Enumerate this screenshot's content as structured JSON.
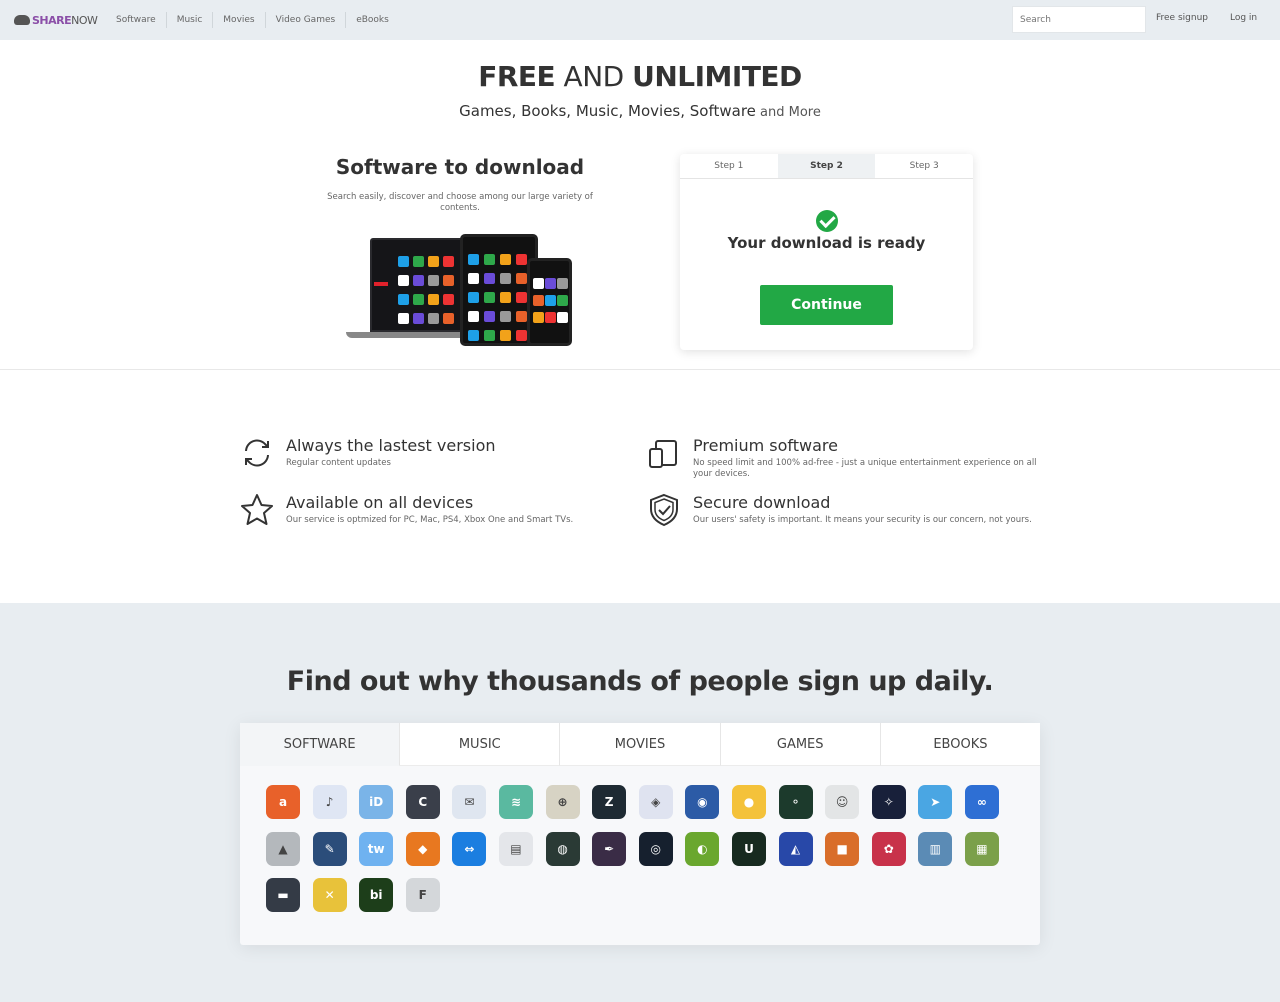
{
  "header": {
    "logo_share": "SHARE",
    "logo_now": "NOW",
    "nav": [
      "Software",
      "Music",
      "Movies",
      "Video Games",
      "eBooks"
    ],
    "search_placeholder": "Search",
    "signup": "Free signup",
    "login": "Log in"
  },
  "hero": {
    "title_free": "FREE",
    "title_and": " AND ",
    "title_unlimited": "UNLIMITED",
    "subtitle_main": "Games, Books, Music, Movies, Software",
    "subtitle_more": " and More"
  },
  "download": {
    "title": "Software to download",
    "description": "Search easily, discover and choose among our large variety of contents.",
    "steps": [
      "Step 1",
      "Step 2",
      "Step 3"
    ],
    "active_step": 1,
    "status": "Your download is ready",
    "continue_label": "Continue"
  },
  "features": [
    {
      "title": "Always the lastest version",
      "desc": "Regular content updates",
      "icon": "refresh-icon"
    },
    {
      "title": "Premium software",
      "desc": "No speed limit and 100% ad-free - just a unique entertainment experience on all your devices.",
      "icon": "devices-icon"
    },
    {
      "title": "Available on all devices",
      "desc": "Our service is optmized for PC, Mac, PS4, Xbox One and Smart TVs.",
      "icon": "star-icon"
    },
    {
      "title": "Secure download",
      "desc": "Our users' safety is important. It means your security is our concern, not yours.",
      "icon": "shield-check-icon"
    }
  ],
  "signup_section": {
    "title": "Find out why thousands of people sign up daily.",
    "tabs": [
      "SOFTWARE",
      "MUSIC",
      "MOVIES",
      "GAMES",
      "EBOOKS"
    ],
    "active_tab": 0,
    "apps": [
      {
        "name": "avast-icon",
        "color": "#e8612a",
        "glyph": "a"
      },
      {
        "name": "audacity-icon",
        "color": "#dfe6f4",
        "glyph": "♪"
      },
      {
        "name": "idrive-icon",
        "color": "#7ab4e8",
        "glyph": "iD"
      },
      {
        "name": "ccleaner-icon",
        "color": "#3a3f4a",
        "glyph": "C"
      },
      {
        "name": "thunderbird-icon",
        "color": "#dfe6f0",
        "glyph": "✉"
      },
      {
        "name": "stack-icon",
        "color": "#5ab9a0",
        "glyph": "≋"
      },
      {
        "name": "compass-icon",
        "color": "#d7d3c4",
        "glyph": "⊕"
      },
      {
        "name": "zoner-icon",
        "color": "#1e2a33",
        "glyph": "Z"
      },
      {
        "name": "shield-app-icon",
        "color": "#dfe3f0",
        "glyph": "◈"
      },
      {
        "name": "pocket-icon",
        "color": "#2c5ba6",
        "glyph": "◉"
      },
      {
        "name": "cow-app-icon",
        "color": "#f4c23a",
        "glyph": "●"
      },
      {
        "name": "gimp-icon",
        "color": "#1c3a2c",
        "glyph": "⚬"
      },
      {
        "name": "waze-icon",
        "color": "#e3e5e6",
        "glyph": "☺"
      },
      {
        "name": "bird-app-icon",
        "color": "#18203a",
        "glyph": "✧"
      },
      {
        "name": "telegram-icon",
        "color": "#4aa6e3",
        "glyph": "➤"
      },
      {
        "name": "link-app-icon",
        "color": "#2e6fd4",
        "glyph": "∞"
      },
      {
        "name": "chart-app-icon",
        "color": "#b4b8bc",
        "glyph": "▲"
      },
      {
        "name": "feather-pen-icon",
        "color": "#2b4d7a",
        "glyph": "✎"
      },
      {
        "name": "twitter-app-icon",
        "color": "#6fb2f0",
        "glyph": "tw"
      },
      {
        "name": "office-app-icon",
        "color": "#e87820",
        "glyph": "◆"
      },
      {
        "name": "teamviewer-icon",
        "color": "#1b7ee0",
        "glyph": "⇔"
      },
      {
        "name": "window-app-icon",
        "color": "#e4e6ea",
        "glyph": "▤"
      },
      {
        "name": "map-app-icon",
        "color": "#2a3a35",
        "glyph": "◍"
      },
      {
        "name": "quill-icon",
        "color": "#3a2c46",
        "glyph": "✒"
      },
      {
        "name": "ring-app-icon",
        "color": "#16202e",
        "glyph": "◎"
      },
      {
        "name": "disc-app-icon",
        "color": "#6aa72e",
        "glyph": "◐"
      },
      {
        "name": "utorrent-icon",
        "color": "#172a1f",
        "glyph": "U"
      },
      {
        "name": "drop-app-icon",
        "color": "#2848a8",
        "glyph": "◭"
      },
      {
        "name": "box-app-icon",
        "color": "#d96e2a",
        "glyph": "■"
      },
      {
        "name": "davinci-icon",
        "color": "#c8324a",
        "glyph": "✿"
      },
      {
        "name": "bars-app-icon",
        "color": "#5b8bb5",
        "glyph": "▥"
      },
      {
        "name": "server-app-icon",
        "color": "#7ba04a",
        "glyph": "▦"
      },
      {
        "name": "keyboard-app-icon",
        "color": "#343b46",
        "glyph": "▬"
      },
      {
        "name": "colors-app-icon",
        "color": "#e8c23a",
        "glyph": "✕"
      },
      {
        "name": "terminal-app-icon",
        "color": "#1d3e1a",
        "glyph": "bi"
      },
      {
        "name": "f-app-icon",
        "color": "#d4d7da",
        "glyph": "F"
      }
    ]
  }
}
